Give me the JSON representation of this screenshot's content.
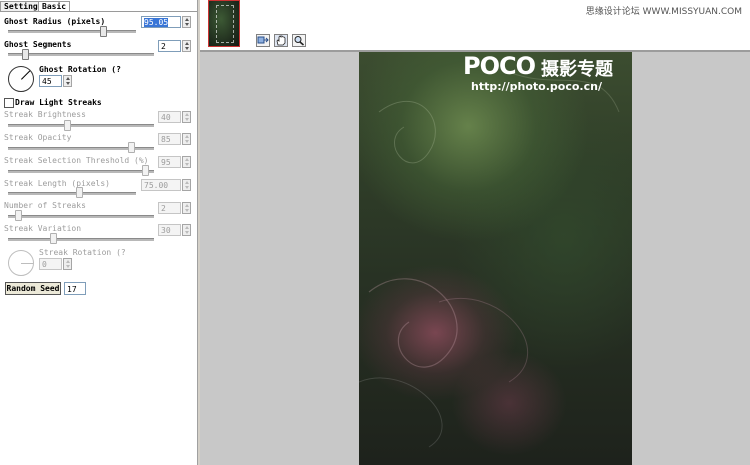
{
  "tabs": [
    {
      "label": "Settings",
      "active": false
    },
    {
      "label": "Basic",
      "active": true
    }
  ],
  "ghost_radius": {
    "label": "Ghost Radius (pixels)",
    "value": "95.05",
    "level": 0.75
  },
  "ghost_segments": {
    "label": "Ghost Segments",
    "value": "2",
    "level": 0.1
  },
  "ghost_rotation": {
    "label": "Ghost Rotation (?",
    "value": "45",
    "angle_deg": 45
  },
  "draw_light_streaks": {
    "label": "Draw Light Streaks",
    "checked": false
  },
  "streak_brightness": {
    "label": "Streak Brightness",
    "value": "40",
    "level": 0.4
  },
  "streak_opacity": {
    "label": "Streak Opacity",
    "value": "85",
    "level": 0.85
  },
  "streak_threshold": {
    "label": "Streak Selection Threshold (%)",
    "value": "95",
    "level": 0.95
  },
  "streak_length": {
    "label": "Streak Length (pixels)",
    "value": "75.00",
    "level": 0.55
  },
  "streak_count": {
    "label": "Number of Streaks",
    "value": "2",
    "level": 0.05
  },
  "streak_variation": {
    "label": "Streak Variation",
    "value": "30",
    "level": 0.3
  },
  "streak_rotation": {
    "label": "Streak Rotation (?",
    "value": "0",
    "angle_deg": 0
  },
  "random_seed": {
    "label": "Random Seed",
    "value": "17"
  },
  "photo_logo": {
    "brand": "POCO",
    "tagline": "摄影专题",
    "url": "http://photo.poco.cn/"
  },
  "site_watermark": "思缘设计论坛 WWW.MISSYUAN.COM",
  "colors": {
    "accent": "#3875d7",
    "thumbnail_border": "#cc3333",
    "workspace": "#c8c8c8"
  },
  "icons": [
    "zoom-fit-icon",
    "hand-icon",
    "magnifier-icon"
  ]
}
